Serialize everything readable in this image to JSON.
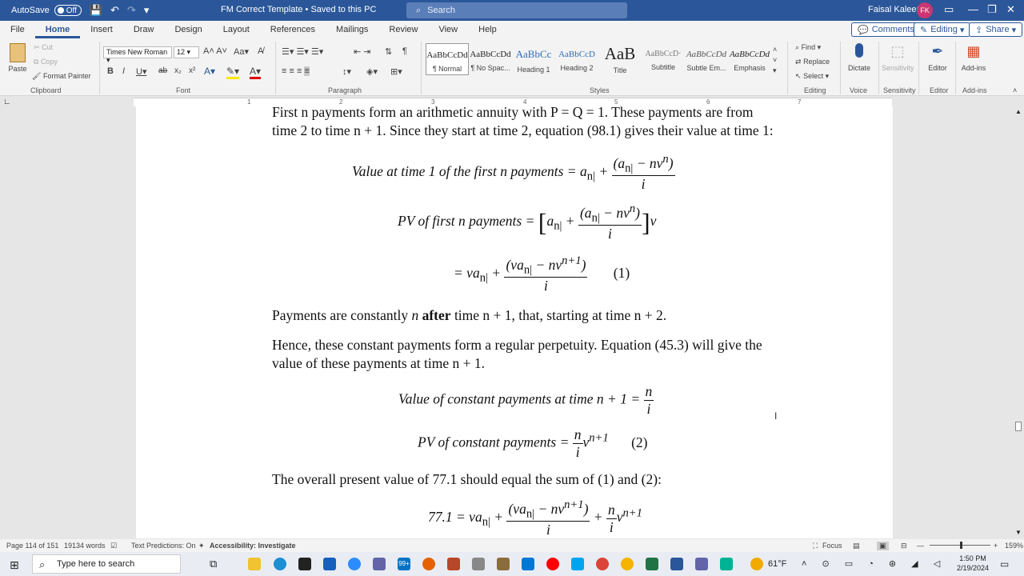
{
  "titlebar": {
    "autosave": "AutoSave",
    "autosave_state": "Off",
    "doc_title": "FM Correct Template • Saved to this PC",
    "search": "Search",
    "user": "Faisal Kaleem",
    "initials": "FK"
  },
  "menu": {
    "tabs": [
      "File",
      "Home",
      "Insert",
      "Draw",
      "Design",
      "Layout",
      "References",
      "Mailings",
      "Review",
      "View",
      "Help"
    ],
    "comments": "Comments",
    "editing": "Editing",
    "share": "Share"
  },
  "ribbon": {
    "clipboard": {
      "paste": "Paste",
      "cut": "Cut",
      "copy": "Copy",
      "painter": "Format Painter",
      "label": "Clipboard"
    },
    "font": {
      "name": "Times New Roman",
      "size": "12",
      "label": "Font"
    },
    "paragraph": {
      "label": "Paragraph"
    },
    "styles": {
      "items": [
        {
          "preview": "AaBbCcDd",
          "name": "¶ Normal"
        },
        {
          "preview": "AaBbCcDd",
          "name": "¶ No Spac..."
        },
        {
          "preview": "AaBbCc",
          "name": "Heading 1"
        },
        {
          "preview": "AaBbCcD",
          "name": "Heading 2"
        },
        {
          "preview": "AaB",
          "name": "Title"
        },
        {
          "preview": "AaBbCcD·",
          "name": "Subtitle"
        },
        {
          "preview": "AaBbCcDd",
          "name": "Subtle Em..."
        },
        {
          "preview": "AaBbCcDd",
          "name": "Emphasis"
        }
      ],
      "label": "Styles"
    },
    "editing": {
      "find": "Find",
      "replace": "Replace",
      "select": "Select",
      "label": "Editing"
    },
    "voice": {
      "dictate": "Dictate",
      "label": "Voice"
    },
    "sensitivity": {
      "btn": "Sensitivity",
      "label": "Sensitivity"
    },
    "editor": {
      "btn": "Editor",
      "label": "Editor"
    },
    "addins": {
      "btn": "Add-ins",
      "label": "Add-ins"
    }
  },
  "ruler": [
    "1",
    "2",
    "3",
    "4",
    "5",
    "6",
    "7"
  ],
  "document": {
    "p1_line1": "First n payments form an arithmetic annuity with P = Q = 1.  These payments are from",
    "p1_line2": "time 2 to time n + 1.  Since they start at time 2, equation (98.1) gives their value at time 1:",
    "eq1_lhs": "Value at time 1 of the first n payments = a",
    "eq1_sub": "n|",
    "eq1_num": "(a",
    "eq1_num2": " − nv",
    "eq1_num_sup": "n",
    "eq1_den": "i",
    "eq2_lhs": "PV of first n payments =",
    "eq3_lhs": "= va",
    "eq3_num": "(va",
    "eq3_num2": " − nv",
    "eq3_num_sup": "n+1",
    "eq3_tag": "(1)",
    "p2_pre": "Payments are constantly ",
    "p2_n": "n",
    "p2_bold": " after",
    "p2_post": " time n + 1, that, starting at time n + 2.",
    "p3_line1": "Hence, these constant payments form a regular perpetuity.  Equation (45.3) will give the",
    "p3_line2": "value of these payments at time n + 1.",
    "eq4_lhs": "Value of constant payments at time n + 1 =",
    "eq4_num": "n",
    "eq4_den": "i",
    "eq5_lhs": "PV of constant payments =",
    "eq5_sup": "n+1",
    "eq5_tag": "(2)",
    "p4": "The overall present value of 77.1 should equal the sum of (1) and (2):",
    "eq6_lhs": "77.1 = va"
  },
  "status": {
    "page": "Page 114 of 151",
    "words": "19134 words",
    "predictions": "Text Predictions: On",
    "accessibility": "Accessibility: Investigate",
    "focus": "Focus",
    "zoom": "159%"
  },
  "taskbar": {
    "search": "Type here to search",
    "weather": "61°F",
    "time": "1:50 PM",
    "date": "2/19/2024",
    "badge": "99+"
  }
}
